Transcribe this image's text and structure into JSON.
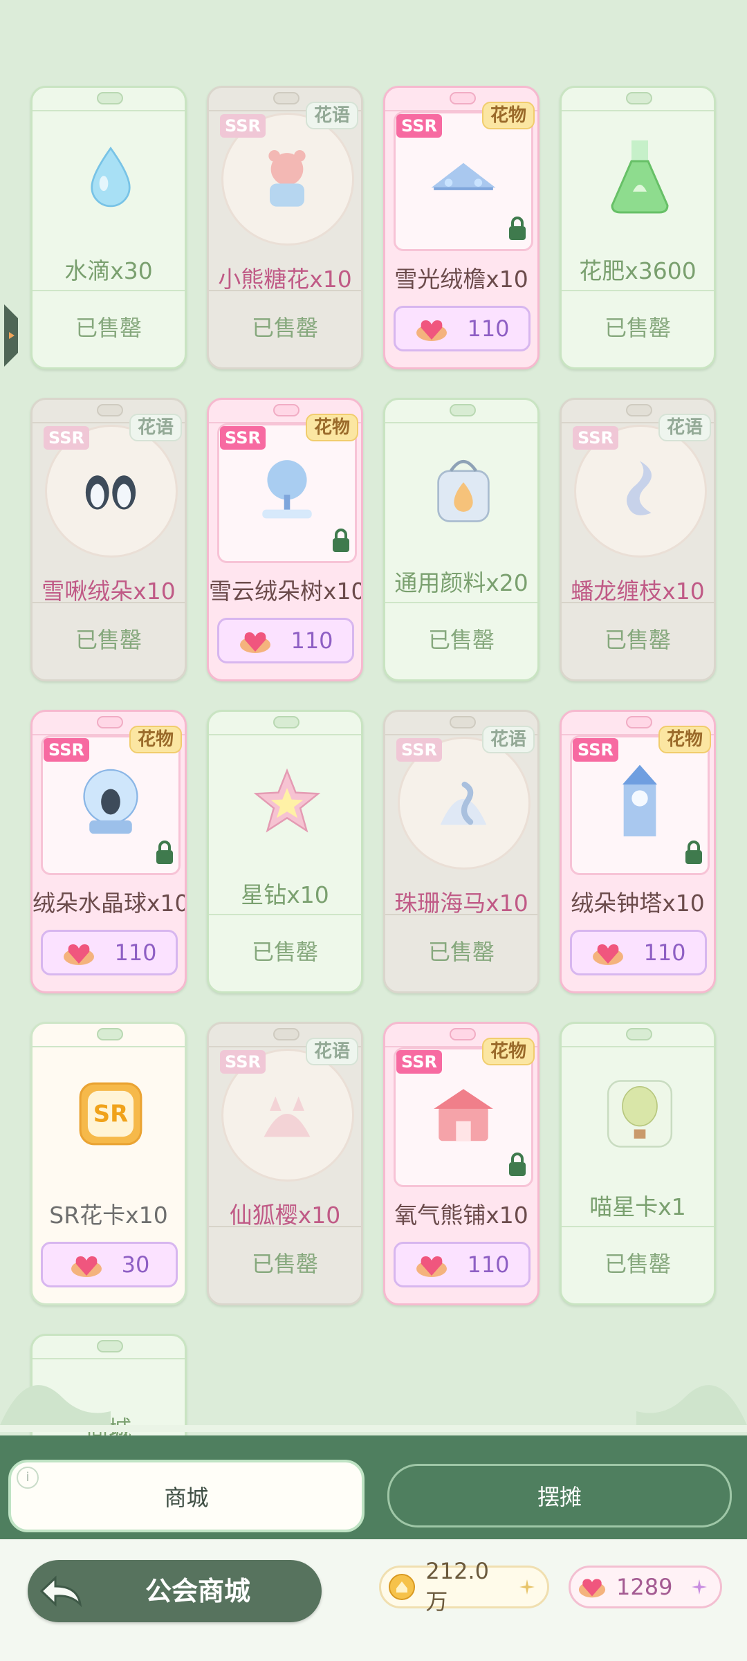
{
  "shop_items": [
    {
      "name": "水滴x30",
      "style": "plain",
      "icon": "water-drop",
      "status": "已售罄"
    },
    {
      "name": "小熊糖花x10",
      "style": "sold-rare",
      "icon": "bear-candy",
      "ssr": "SSR",
      "tag": "花语",
      "status": "已售罄"
    },
    {
      "name": "雪光绒檐x10",
      "style": "pink",
      "icon": "snow-eave",
      "ssr": "SSR",
      "tag": "花物",
      "locked": true,
      "price": "110"
    },
    {
      "name": "花肥x3600",
      "style": "plain",
      "icon": "fertilizer-flask",
      "status": "已售罄"
    },
    {
      "name": "雪啾绒朵x10",
      "style": "sold-rare",
      "icon": "penguins",
      "ssr": "SSR",
      "tag": "花语",
      "status": "已售罄"
    },
    {
      "name": "雪云绒朵树x10",
      "style": "pink",
      "icon": "snow-tree",
      "ssr": "SSR",
      "tag": "花物",
      "locked": true,
      "price": "110"
    },
    {
      "name": "通用颜料x20",
      "style": "plain",
      "icon": "paint-bucket",
      "status": "已售罄"
    },
    {
      "name": "蟠龙缠枝x10",
      "style": "sold-rare",
      "icon": "dragon",
      "ssr": "SSR",
      "tag": "花语",
      "status": "已售罄"
    },
    {
      "name": "绒朵水晶球x10",
      "style": "pink",
      "icon": "crystal-ball",
      "ssr": "SSR",
      "tag": "花物",
      "locked": true,
      "price": "110"
    },
    {
      "name": "星钻x10",
      "style": "plain",
      "icon": "star-diamond",
      "status": "已售罄"
    },
    {
      "name": "珠珊海马x10",
      "style": "sold-rare",
      "icon": "seahorse",
      "ssr": "SSR",
      "tag": "花语",
      "status": "已售罄"
    },
    {
      "name": "绒朵钟塔x10",
      "style": "pink",
      "icon": "clock-tower",
      "ssr": "SSR",
      "tag": "花物",
      "locked": true,
      "price": "110"
    },
    {
      "name": "SR花卡x10",
      "style": "cream",
      "icon": "sr-card",
      "price": "30"
    },
    {
      "name": "仙狐樱x10",
      "style": "sold-rare",
      "icon": "fox",
      "ssr": "SSR",
      "tag": "花语",
      "status": "已售罄"
    },
    {
      "name": "氧气熊铺x10",
      "style": "pink",
      "icon": "bear-shop",
      "ssr": "SSR",
      "tag": "花物",
      "locked": true,
      "price": "110"
    },
    {
      "name": "喵星卡x1",
      "style": "plain",
      "icon": "balloon-card",
      "status": "已售罄"
    },
    {
      "name": "商城",
      "style": "plain",
      "icon": "none"
    }
  ],
  "tabs": {
    "left": "商城",
    "right": "摆摊"
  },
  "footer": {
    "title": "公会商城",
    "gold": "212.0万",
    "hearts": "1289"
  },
  "colors": {
    "background": "#dcecd9",
    "tab_bar": "#4f7f5f",
    "accent_pink": "#f76aa1",
    "price_purple": "#8e5fc4"
  }
}
